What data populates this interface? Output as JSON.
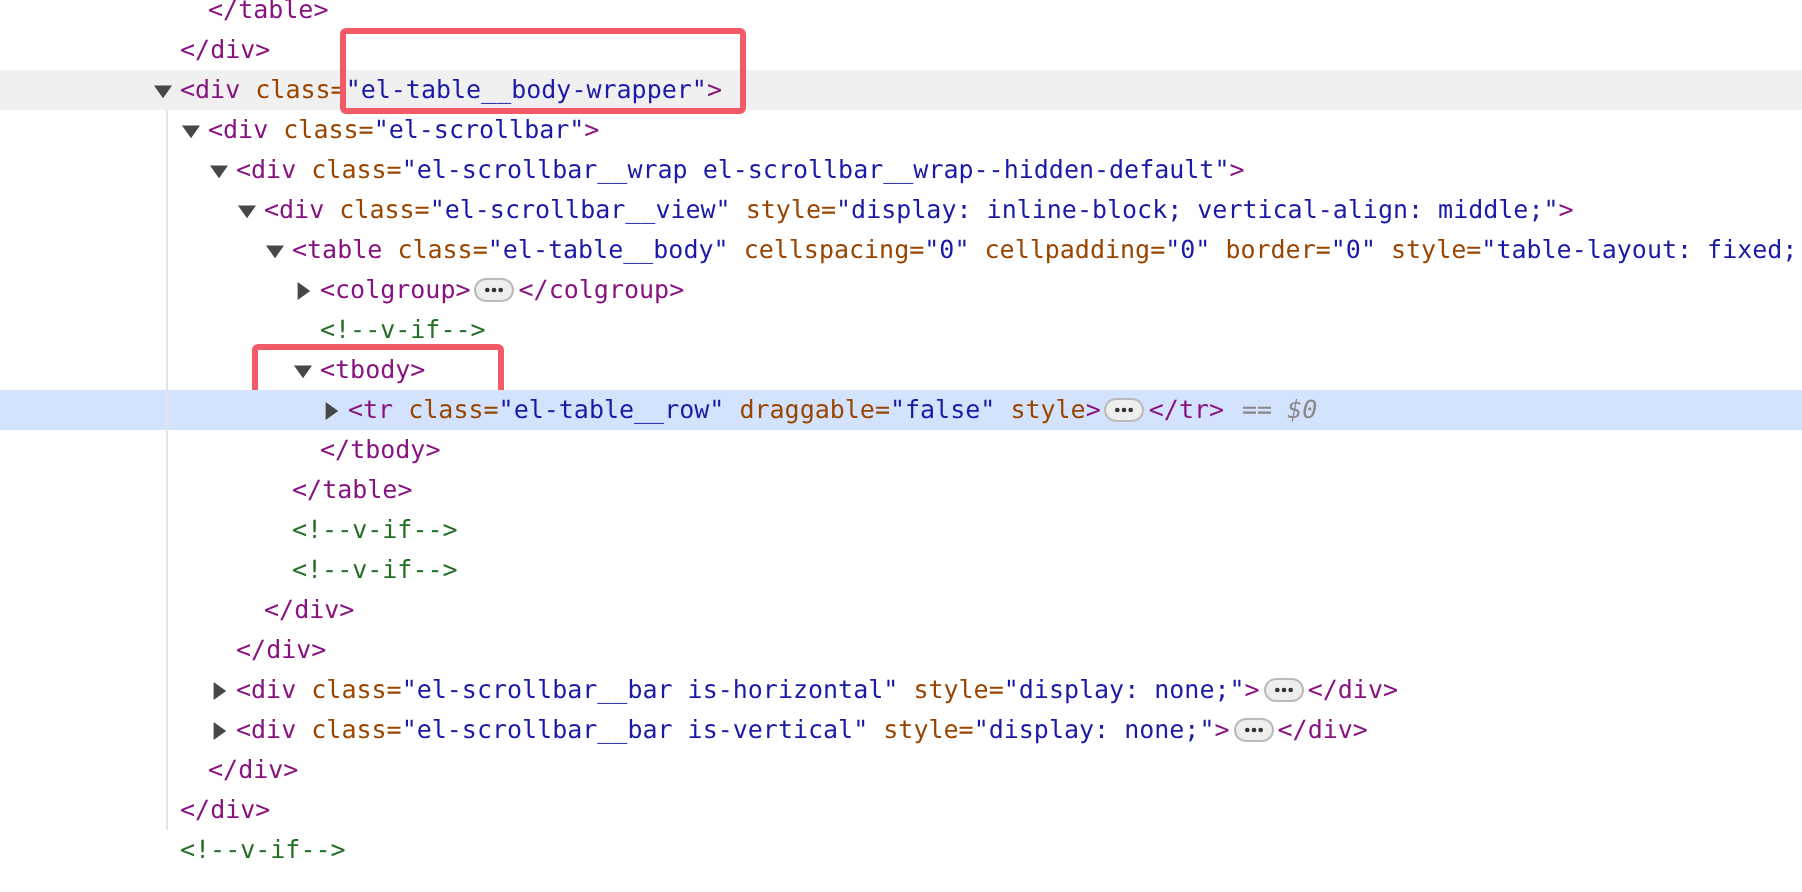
{
  "elements_tree": [
    {
      "children": [
        {
          "text": "</table>"
        }
      ],
      "close": "</div>"
    },
    {
      "text": "<div class=\"el-table__body-wrapper\">",
      "expanded": true,
      "hovered": true,
      "selected": false,
      "highlighted": true,
      "close": "</div>",
      "children": [
        {
          "text": "<div class=\"el-scrollbar\">",
          "expanded": true,
          "hovered": false,
          "selected": false,
          "highlighted": false,
          "close": "</div>",
          "children": [
            {
              "text": "<div class=\"el-scrollbar__wrap el-scrollbar__wrap--hidden-default\">",
              "expanded": true,
              "hovered": false,
              "selected": false,
              "highlighted": false,
              "close": "</div>",
              "children": [
                {
                  "text": "<div class=\"el-scrollbar__view\" style=\"display: inline-block; vertical-align: middle;\">",
                  "expanded": true,
                  "hovered": false,
                  "selected": false,
                  "highlighted": false,
                  "close": "</div>",
                  "children": [
                    {
                      "text": "<table class=\"el-table__body\" cellspacing=\"0\" cellpadding=\"0\" border=\"0\" style=\"table-layout: fixed;",
                      "expanded": true,
                      "hovered": false,
                      "selected": false,
                      "highlighted": false,
                      "close": "</table>",
                      "children": [
                        {
                          "text": "<colgroup>",
                          "expanded": false,
                          "hovered": false,
                          "selected": false,
                          "highlighted": false,
                          "inline_close": "</colgroup>"
                        },
                        {
                          "text": "<!--v-if-->"
                        },
                        {
                          "text": "<tbody>",
                          "expanded": true,
                          "hovered": false,
                          "selected": false,
                          "highlighted": true,
                          "close": "</tbody>",
                          "children": [
                            {
                              "text": "<tr class=\"el-table__row\" draggable=\"false\" style>",
                              "expanded": false,
                              "hovered": false,
                              "selected": true,
                              "highlighted": false,
                              "inline_close": "</tr>",
                              "suffix": "== $0"
                            }
                          ]
                        }
                      ]
                    },
                    {
                      "text": "<!--v-if-->"
                    },
                    {
                      "text": "<!--v-if-->"
                    }
                  ]
                }
              ]
            },
            {
              "text": "<div class=\"el-scrollbar__bar is-horizontal\" style=\"display: none;\">",
              "expanded": false,
              "hovered": false,
              "selected": false,
              "highlighted": false,
              "inline_close": "</div>"
            },
            {
              "text": "<div class=\"el-scrollbar__bar is-vertical\" style=\"display: none;\">",
              "expanded": false,
              "hovered": false,
              "selected": false,
              "highlighted": false,
              "inline_close": "</div>"
            }
          ]
        }
      ]
    },
    {
      "text": "<!--v-if-->"
    }
  ]
}
